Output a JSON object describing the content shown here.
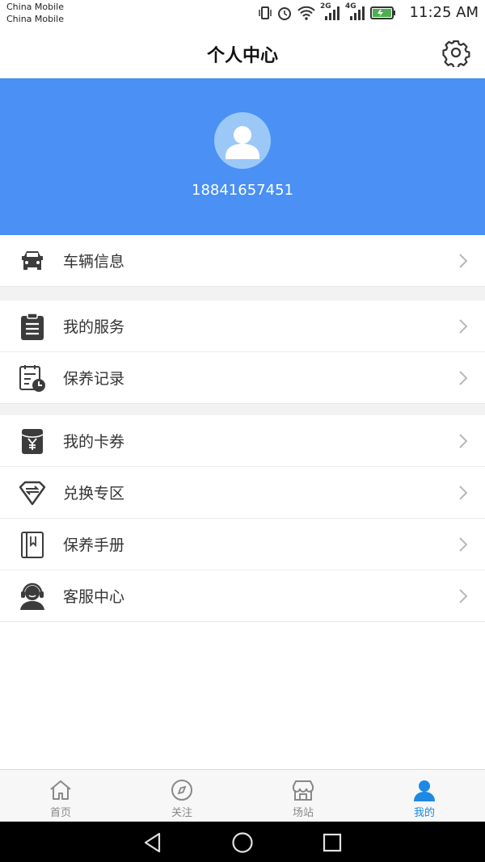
{
  "status_bar": {
    "carrier_1": "China Mobile",
    "carrier_2": "China Mobile",
    "network_1": "2G",
    "network_2": "4G",
    "time": "11:25 AM",
    "battery_color": "#4caf50"
  },
  "header": {
    "title": "个人中心",
    "settings_icon": "gear-icon"
  },
  "profile": {
    "phone": "18841657451",
    "banner_color": "#4a90f5"
  },
  "menu": {
    "group_1": [
      {
        "label": "车辆信息",
        "icon": "car-icon"
      }
    ],
    "group_2": [
      {
        "label": "我的服务",
        "icon": "clipboard-icon"
      },
      {
        "label": "保养记录",
        "icon": "calendar-clock-icon"
      }
    ],
    "group_3": [
      {
        "label": "我的卡券",
        "icon": "yuan-card-icon"
      },
      {
        "label": "兑换专区",
        "icon": "diamond-exchange-icon"
      },
      {
        "label": "保养手册",
        "icon": "book-icon"
      },
      {
        "label": "客服中心",
        "icon": "headset-agent-icon"
      }
    ]
  },
  "bottom_nav": {
    "tabs": [
      {
        "label": "首页",
        "icon": "home-icon",
        "active": false
      },
      {
        "label": "关注",
        "icon": "compass-icon",
        "active": false
      },
      {
        "label": "场站",
        "icon": "store-icon",
        "active": false
      },
      {
        "label": "我的",
        "icon": "user-icon",
        "active": true
      }
    ],
    "active_color": "#1e88e5",
    "inactive_color": "#888888"
  }
}
